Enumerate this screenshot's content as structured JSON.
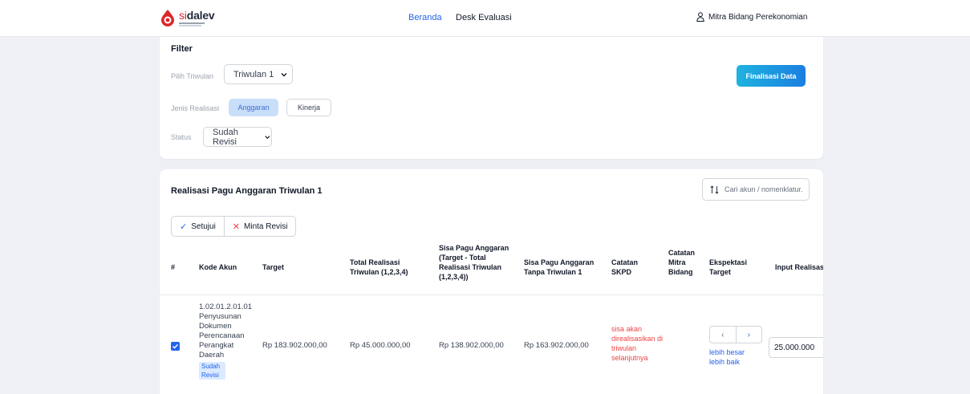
{
  "brand": {
    "prefix": "si",
    "name": "dalev"
  },
  "nav": {
    "beranda": "Beranda",
    "desk_evaluasi": "Desk Evaluasi",
    "user": "Mitra Bidang Perekonomian"
  },
  "filter": {
    "title": "Filter",
    "triwulan_label": "Pilih Triwulan",
    "triwulan_value": "Triwulan 1",
    "jenis_label": "Jenis Realisasi",
    "jenis_options": [
      "Anggaran",
      "Kinerja"
    ],
    "jenis_selected": "Anggaran",
    "status_label": "Status",
    "status_value": "Sudah Revisi",
    "finalisasi_button": "Finalisasi Data"
  },
  "table": {
    "title": "Realisasi Pagu Anggaran Triwulan 1",
    "search_placeholder": "Cari akun / nomenklatur.",
    "approve_label": "Setujui",
    "revise_label": "Minta Revisi",
    "headers": {
      "no": "#",
      "kode": "Kode Akun",
      "target": "Target",
      "total": "Total Realisasi Triwulan (1,2,3,4)",
      "sisa_pagu": "Sisa Pagu Anggaran (Target - Total Realisasi Triwulan (1,2,3,4))",
      "sisa_tanpa": "Sisa Pagu Anggaran Tanpa Triwulan 1",
      "catatan_skpd": "Catatan SKPD",
      "catatan_mitra": "Catatan Mitra Bidang",
      "ekspektasi": "Ekspektasi Target",
      "input": "Input Realisasi"
    },
    "rows": [
      {
        "checked": true,
        "kode": "1.02.01.2.01.01",
        "nama": "Penyusunan Dokumen Perencanaan Perangkat Daerah",
        "status_badge": "Sudah Revisi",
        "target": "Rp 183.902.000,00",
        "total": "Rp 45.000.000,00",
        "sisa_pagu": "Rp 138.902.000,00",
        "sisa_tanpa": "Rp 163.902.000,00",
        "catatan_skpd": "sisa akan direalisasikan di triwulan selanjutnya",
        "catatan_mitra": "",
        "ekspektasi": "lebih besar lebih baik",
        "input_value": "25.000.000"
      }
    ]
  },
  "colors": {
    "accent": "#2563eb",
    "danger": "#ef4444",
    "brand_red": "#dc2626",
    "pill_bg": "#c9def9"
  },
  "icons": [
    "logo-icon",
    "user-icon",
    "chevron-down-icon",
    "search-icon",
    "check-icon",
    "close-icon",
    "chevron-left-icon",
    "chevron-right-icon"
  ]
}
